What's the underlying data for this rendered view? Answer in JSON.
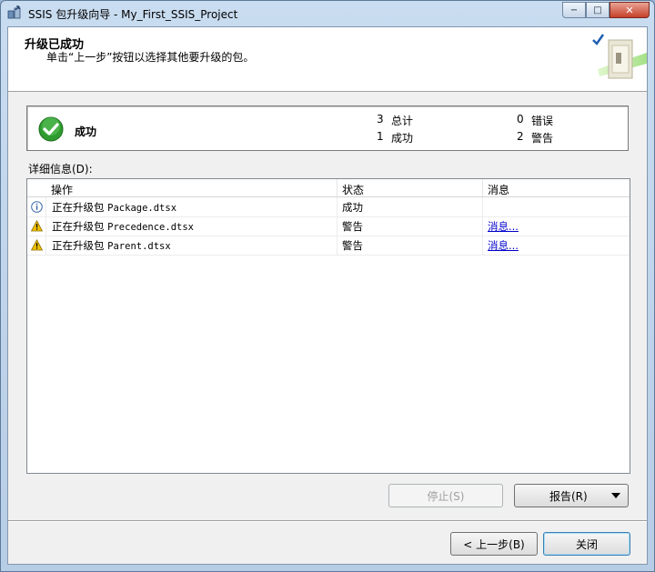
{
  "window": {
    "title": "SSIS 包升级向导 - My_First_SSIS_Project",
    "minimize": "−",
    "maximize": "□",
    "close": "✕"
  },
  "header": {
    "title": "升级已成功",
    "subtitle": "单击“上一步”按钮以选择其他要升级的包。"
  },
  "summary": {
    "status": "成功",
    "total_count": "3",
    "total_label": "总计",
    "success_count": "1",
    "success_label": "成功",
    "error_count": "0",
    "error_label": "错误",
    "warning_count": "2",
    "warning_label": "警告"
  },
  "details_label": "详细信息(D):",
  "grid": {
    "columns": [
      "操作",
      "状态",
      "消息"
    ],
    "rows": [
      {
        "icon": "info-icon",
        "action_prefix": "正在升级包",
        "file": "Package.dtsx",
        "status": "成功",
        "message": ""
      },
      {
        "icon": "warning-icon",
        "action_prefix": "正在升级包",
        "file": "Precedence.dtsx",
        "status": "警告",
        "message": "消息..."
      },
      {
        "icon": "warning-icon",
        "action_prefix": "正在升级包",
        "file": "Parent.dtsx",
        "status": "警告",
        "message": "消息..."
      }
    ]
  },
  "buttons": {
    "stop": "停止(S)",
    "report": "报告(R)",
    "back": "< 上一步(B)",
    "close": "关闭"
  },
  "colors": {
    "success_green": "#2e9b2e",
    "warning_yellow": "#f2c200",
    "link_blue": "#0000cc"
  }
}
